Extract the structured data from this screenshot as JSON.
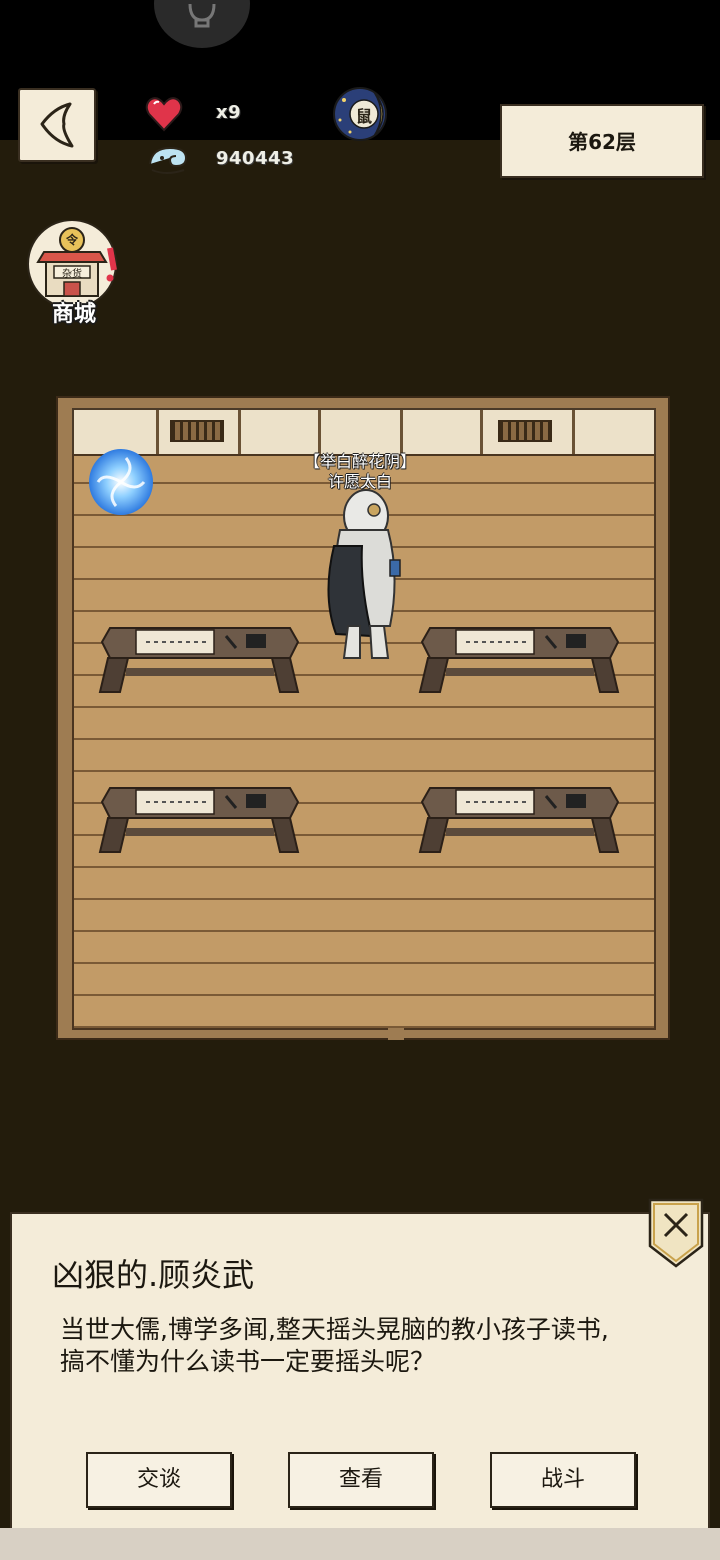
{
  "hud": {
    "lives": "x9",
    "currency": "940443",
    "floor_label": "第62层",
    "shop_label": "商城",
    "shop_sign": "杂货",
    "shop_coin": "令",
    "moon_badge": "鼠"
  },
  "npc": {
    "title": "【举白醉花阴】",
    "name": "许愿太白"
  },
  "dialog": {
    "title": "凶狠的.顾炎武",
    "body_line1": "当世大儒,博学多闻,整天摇头晃脑的教小孩子读书,",
    "body_line2": "搞不懂为什么读书一定要摇头呢？",
    "buttons": [
      "交谈",
      "查看",
      "战斗"
    ]
  },
  "colors": {
    "paper": "#f4ecd9",
    "background": "#231c0c",
    "floor_wood": "#b8915f",
    "heart": "#e0344a",
    "portal": "#5aa8ff"
  },
  "icons": [
    "back-icon",
    "heart-icon",
    "spirit-icon",
    "moon-zodiac-icon",
    "shop-icon",
    "portal-icon",
    "close-icon"
  ]
}
